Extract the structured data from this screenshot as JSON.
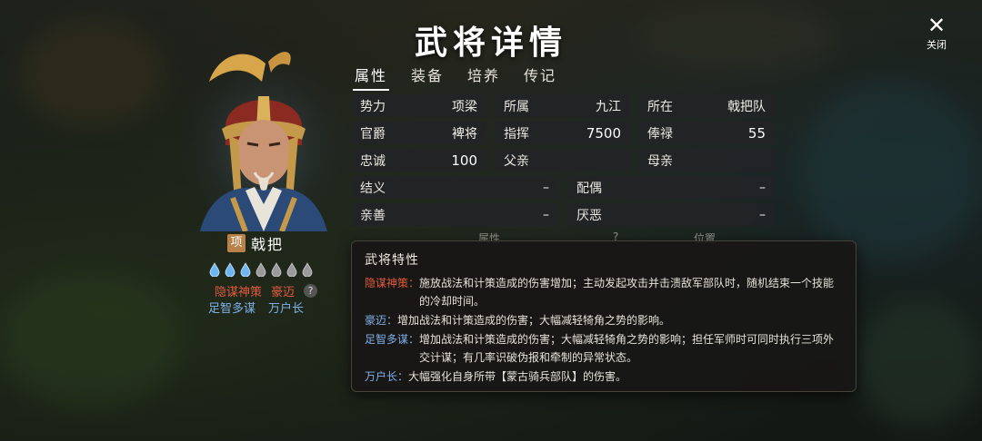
{
  "header": {
    "title": "武将详情",
    "close_label": "关闭"
  },
  "tabs": [
    {
      "label": "属性",
      "active": true
    },
    {
      "label": "装备",
      "active": false
    },
    {
      "label": "培养",
      "active": false
    },
    {
      "label": "传记",
      "active": false
    }
  ],
  "info": {
    "faction": {
      "label": "势力",
      "value": "项梁"
    },
    "affiliation": {
      "label": "所属",
      "value": "九江"
    },
    "location": {
      "label": "所在",
      "value": "戟把队"
    },
    "rank": {
      "label": "官爵",
      "value": "裨将"
    },
    "command": {
      "label": "指挥",
      "value": "7500"
    },
    "salary": {
      "label": "俸禄",
      "value": "55"
    },
    "loyalty": {
      "label": "忠诚",
      "value": "100"
    },
    "father": {
      "label": "父亲",
      "value": ""
    },
    "mother": {
      "label": "母亲",
      "value": ""
    },
    "sworn": {
      "label": "结义",
      "value": "–"
    },
    "spouse": {
      "label": "配偶",
      "value": "–"
    },
    "likes": {
      "label": "亲善",
      "value": "–"
    },
    "dislikes": {
      "label": "厌恶",
      "value": "–"
    }
  },
  "hero": {
    "faction_badge": "项",
    "name": "戟把",
    "stars_total": 7,
    "stars_lit": 3,
    "traits_row1": [
      "隐谋神策",
      "豪迈"
    ],
    "traits_row2": [
      "足智多谋",
      "万户长"
    ],
    "help": "?"
  },
  "behind_labels": {
    "attr": "属性",
    "help": "?",
    "pos": "位置"
  },
  "popup": {
    "title": "武将特性",
    "traits": [
      {
        "name": "隐谋神策：",
        "desc": "施放战法和计策造成的伤害增加；主动发起攻击并击溃敌军部队时，随机结束一个技能的冷却时间。",
        "color": "#e05a3c"
      },
      {
        "name": "豪迈：",
        "desc": "增加战法和计策造成的伤害；大幅减轻犄角之势的影响。",
        "color": "#7fb1e8"
      },
      {
        "name": "足智多谋：",
        "desc": "增加战法和计策造成的伤害；大幅减轻犄角之势的影响；担任军师时可同时执行三项外交计谋；有几率识破伪报和牵制的异常状态。",
        "color": "#7fb1e8"
      },
      {
        "name": "万户长：",
        "desc": "大幅强化自身所带【蒙古骑兵部队】的伤害。",
        "color": "#7fb1e8"
      }
    ]
  }
}
